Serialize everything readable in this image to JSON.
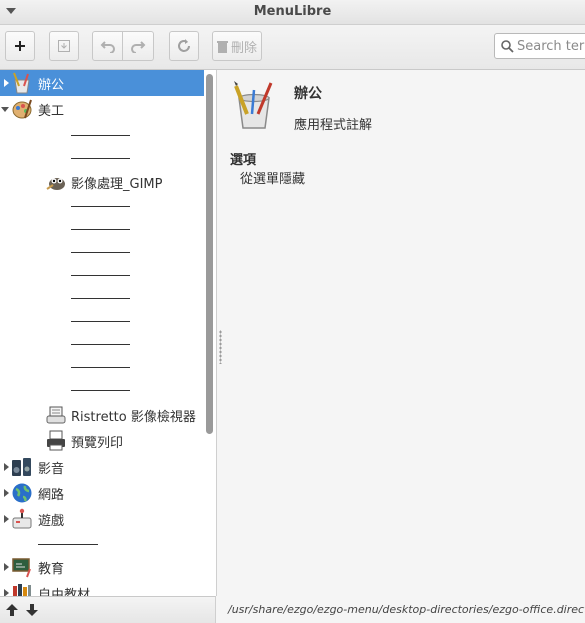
{
  "window": {
    "title": "MenuLibre"
  },
  "toolbar": {
    "add_icon": "plus-icon",
    "save_icon": "save-icon",
    "undo_icon": "undo-icon",
    "redo_icon": "redo-icon",
    "revert_icon": "revert-icon",
    "delete_label": "刪除",
    "search_placeholder": "Search terms"
  },
  "tree": {
    "items": [
      {
        "label": "辦公",
        "icon": "office-icon",
        "level": 0,
        "expander": "collapsed",
        "selected": true
      },
      {
        "label": "美工",
        "icon": "graphics-icon",
        "level": 0,
        "expander": "expanded"
      },
      {
        "label": "",
        "separator": true,
        "level": 1
      },
      {
        "label": "",
        "separator": true,
        "level": 1
      },
      {
        "label": "影像處理_GIMP",
        "icon": "gimp-icon",
        "level": 1
      },
      {
        "label": "",
        "separator": true,
        "level": 1
      },
      {
        "label": "",
        "separator": true,
        "level": 1
      },
      {
        "label": "",
        "separator": true,
        "level": 1
      },
      {
        "label": "",
        "separator": true,
        "level": 1
      },
      {
        "label": "",
        "separator": true,
        "level": 1
      },
      {
        "label": "",
        "separator": true,
        "level": 1
      },
      {
        "label": "",
        "separator": true,
        "level": 1
      },
      {
        "label": "",
        "separator": true,
        "level": 1
      },
      {
        "label": "",
        "separator": true,
        "level": 1
      },
      {
        "label": "Ristretto 影像檢視器",
        "icon": "image-viewer-icon",
        "level": 1
      },
      {
        "label": "預覽列印",
        "icon": "print-preview-icon",
        "level": 1
      },
      {
        "label": "影音",
        "icon": "multimedia-icon",
        "level": 0,
        "expander": "collapsed"
      },
      {
        "label": "網路",
        "icon": "internet-icon",
        "level": 0,
        "expander": "collapsed"
      },
      {
        "label": "遊戲",
        "icon": "games-icon",
        "level": 0,
        "expander": "collapsed"
      },
      {
        "label": "",
        "separator": true,
        "level": 0
      },
      {
        "label": "教育",
        "icon": "education-icon",
        "level": 0,
        "expander": "collapsed"
      },
      {
        "label": "自由教材",
        "icon": "books-icon",
        "level": 0,
        "expander": "collapsed"
      }
    ],
    "footer": {
      "move_up_icon": "arrow-up-icon",
      "move_down_icon": "arrow-down-icon"
    }
  },
  "detail": {
    "name": "辦公",
    "comment": "應用程式註解",
    "options_heading": "選項",
    "hide_option": "從選單隱藏",
    "path": "/usr/share/ezgo/ezgo-menu/desktop-directories/ezgo-office.directory"
  },
  "colors": {
    "selection": "#4a90d9",
    "background": "#f5f5f5"
  }
}
